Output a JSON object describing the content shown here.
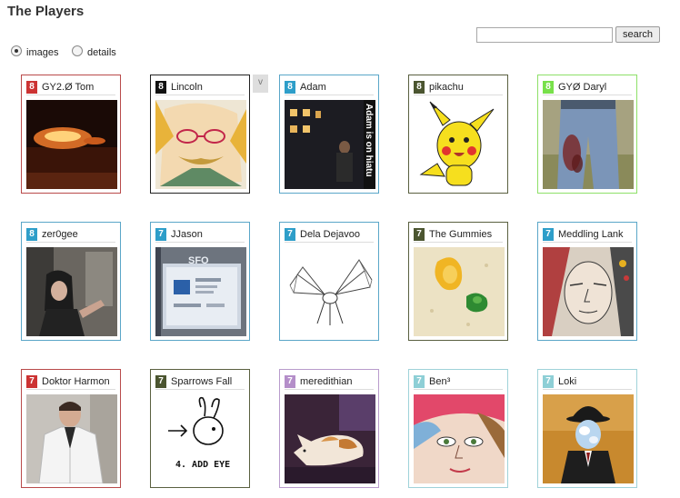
{
  "page": {
    "title": "The Players"
  },
  "search": {
    "value": "",
    "button_label": "search"
  },
  "view_toggle": [
    {
      "label": "images",
      "checked": true
    },
    {
      "label": "details",
      "checked": false
    }
  ],
  "collapse_tab_label": "v",
  "players": [
    {
      "rank": "8",
      "name": "GY2.Ø Tom",
      "badge_color": "#cc3333",
      "border_color": "#b94a4a",
      "photo": "fire-night-icon"
    },
    {
      "rank": "8",
      "name": "Lincoln",
      "badge_color": "#111111",
      "border_color": "#222222",
      "photo": "sketch-face-icon"
    },
    {
      "rank": "8",
      "name": "Adam",
      "badge_color": "#2e9ec9",
      "border_color": "#5aa6c8",
      "photo": "night-street-icon"
    },
    {
      "rank": "8",
      "name": "pikachu",
      "badge_color": "#4b5530",
      "border_color": "#5a6040",
      "photo": "pikachu-icon"
    },
    {
      "rank": "8",
      "name": "GYØ Daryl",
      "badge_color": "#78e04a",
      "border_color": "#8ee068",
      "photo": "jeans-icon"
    },
    {
      "rank": "8",
      "name": "zer0gee",
      "badge_color": "#2e9ec9",
      "border_color": "#5aa6c8",
      "photo": "portrait-dark-icon"
    },
    {
      "rank": "7",
      "name": "JJason",
      "badge_color": "#2e9ec9",
      "border_color": "#5aa6c8",
      "photo": "screen-icon"
    },
    {
      "rank": "7",
      "name": "Dela Dejavoo",
      "badge_color": "#2e9ec9",
      "border_color": "#5aa6c8",
      "photo": "bat-skeleton-icon"
    },
    {
      "rank": "7",
      "name": "The Gummies",
      "badge_color": "#4b5530",
      "border_color": "#5a6040",
      "photo": "gummies-icon"
    },
    {
      "rank": "7",
      "name": "Meddling Lank",
      "badge_color": "#2e9ec9",
      "border_color": "#5aa6c8",
      "photo": "painted-face-icon"
    },
    {
      "rank": "7",
      "name": "Doktor Harmon",
      "badge_color": "#cc3333",
      "border_color": "#b94a4a",
      "photo": "labcoat-icon"
    },
    {
      "rank": "7",
      "name": "Sparrows Fall",
      "badge_color": "#4b5530",
      "border_color": "#5a6040",
      "photo": "bunny-doodle-icon"
    },
    {
      "rank": "7",
      "name": "meredithian",
      "badge_color": "#b48ec9",
      "border_color": "#b99bcc",
      "photo": "cat-icon"
    },
    {
      "rank": "7",
      "name": "Ben³",
      "badge_color": "#8ecfd6",
      "border_color": "#9fd2d9",
      "photo": "colorful-face-icon"
    },
    {
      "rank": "7",
      "name": "Loki",
      "badge_color": "#8ecfd6",
      "border_color": "#9fd2d9",
      "photo": "bowler-hat-icon"
    }
  ],
  "photo_texts": {
    "adam_sign": "Adam is on hiatu",
    "sparrows_caption": "4. ADD EYE",
    "jason_screen": "SFO"
  }
}
